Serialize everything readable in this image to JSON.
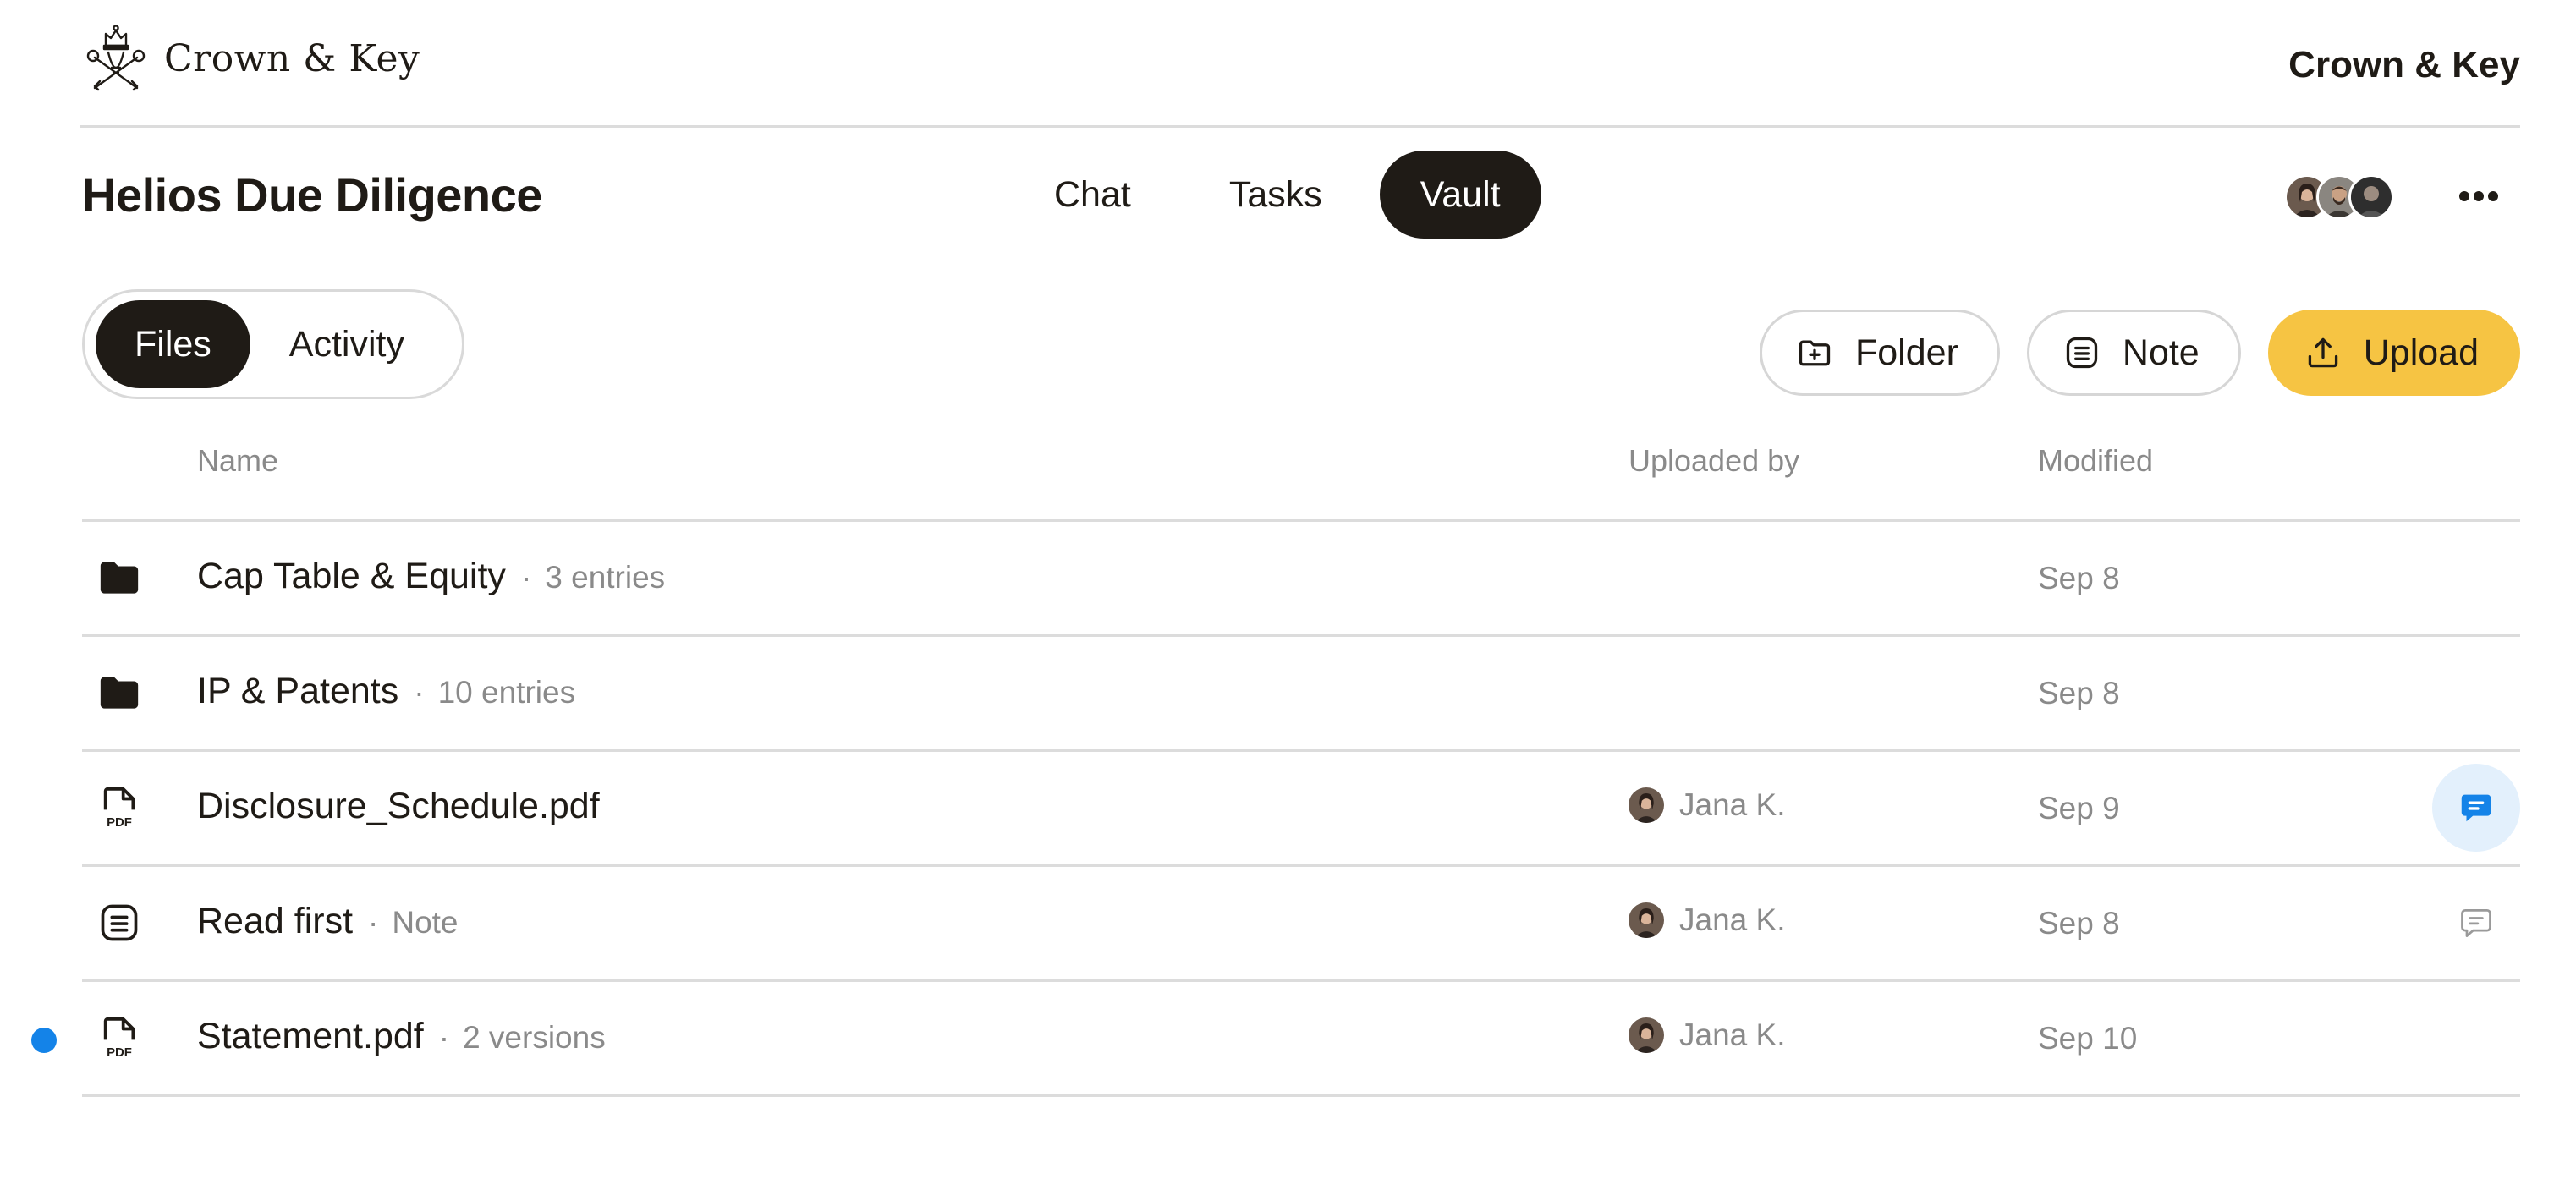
{
  "brand": {
    "logo_text": "Crown & Key",
    "right_text": "Crown & Key"
  },
  "project": {
    "title": "Helios Due Diligence"
  },
  "tabs": [
    {
      "label": "Chat",
      "active": false
    },
    {
      "label": "Tasks",
      "active": false
    },
    {
      "label": "Vault",
      "active": true
    }
  ],
  "members": {
    "avatars": [
      "avatar-woman",
      "avatar-man-beard",
      "avatar-man-dark"
    ]
  },
  "segment": {
    "files": "Files",
    "activity": "Activity",
    "active": "Files"
  },
  "actions": {
    "folder": "Folder",
    "note": "Note",
    "upload": "Upload"
  },
  "table": {
    "headers": {
      "name": "Name",
      "uploaded_by": "Uploaded by",
      "modified": "Modified"
    },
    "rows": [
      {
        "icon": "folder-icon",
        "name": "Cap Table & Equity",
        "meta": "3 entries",
        "uploader": "",
        "modified": "Sep 8",
        "comment": "none",
        "unread": false
      },
      {
        "icon": "folder-icon",
        "name": "IP & Patents",
        "meta": "10 entries",
        "uploader": "",
        "modified": "Sep 8",
        "comment": "none",
        "unread": false
      },
      {
        "icon": "pdf-icon",
        "name": "Disclosure_Schedule.pdf",
        "meta": "",
        "uploader": "Jana K.",
        "modified": "Sep 9",
        "comment": "active",
        "unread": false
      },
      {
        "icon": "note-icon",
        "name": "Read first",
        "meta": "Note",
        "uploader": "Jana K.",
        "modified": "Sep 8",
        "comment": "idle",
        "unread": false
      },
      {
        "icon": "pdf-icon",
        "name": "Statement.pdf",
        "meta": "2 versions",
        "uploader": "Jana K.",
        "modified": "Sep 10",
        "comment": "none",
        "unread": true
      }
    ]
  },
  "colors": {
    "ink": "#1f1b16",
    "accent": "#f6c443",
    "unread": "#1483e8",
    "muted": "#8a8a8a"
  }
}
